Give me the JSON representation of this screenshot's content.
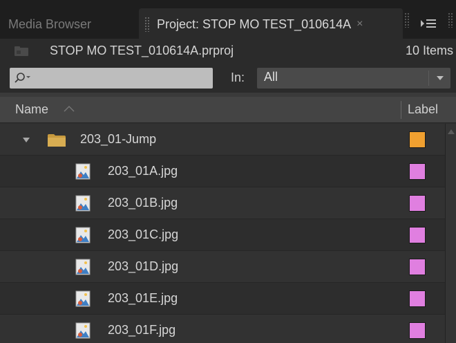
{
  "tabs": {
    "media_browser": "Media Browser",
    "project": "Project: STOP MO TEST_010614A",
    "close_glyph": "×"
  },
  "project": {
    "file_name": "STOP MO TEST_010614A.prproj",
    "item_count": "10 Items"
  },
  "search": {
    "value": "",
    "in_label": "In:",
    "in_selected": "All"
  },
  "columns": {
    "name": "Name",
    "label": "Label"
  },
  "items": [
    {
      "name": "203_01-Jump",
      "type": "bin",
      "expanded": true,
      "label_color": "#f0a030"
    },
    {
      "name": "203_01A.jpg",
      "type": "image",
      "label_color": "#e07fe0"
    },
    {
      "name": "203_01B.jpg",
      "type": "image",
      "label_color": "#e07fe0"
    },
    {
      "name": "203_01C.jpg",
      "type": "image",
      "label_color": "#e07fe0"
    },
    {
      "name": "203_01D.jpg",
      "type": "image",
      "label_color": "#e07fe0"
    },
    {
      "name": "203_01E.jpg",
      "type": "image",
      "label_color": "#e07fe0"
    },
    {
      "name": "203_01F.jpg",
      "type": "image",
      "label_color": "#e07fe0"
    }
  ],
  "icons": {
    "project": "project-file-icon",
    "search": "search-icon",
    "panel_menu": "panel-menu-icon",
    "dropdown": "chevron-down-icon",
    "sort": "sort-ascending-icon",
    "twisty": "disclosure-triangle-icon",
    "bin": "folder-icon",
    "image": "image-file-icon"
  }
}
